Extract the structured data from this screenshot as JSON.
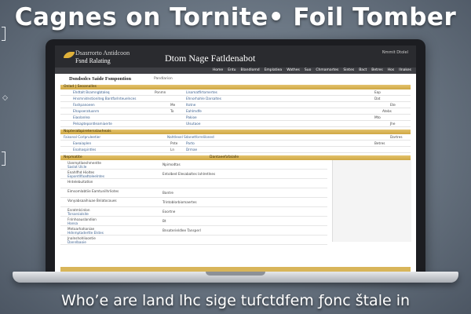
{
  "headline": "Cagnes on Tornite• Foil Tomber",
  "caption": "Who’e are land lhc sige tufctdfem ƒonc štale in",
  "site": {
    "logo_text": "Dsasrrorto Antidcoon",
    "logo_sub": "Fsnd Ralating",
    "title": "Dtom Nage Fatldenabot",
    "header_link": "Nmmit Dtolel",
    "nav": [
      "Home",
      "Entu",
      "Blandlomd",
      "Emplatiea",
      "Wathes",
      "Suo",
      "Chmamartes",
      "Sintes",
      "Bact",
      "Betres",
      "Hos",
      "Ilnakes"
    ]
  },
  "page": {
    "title": "Dsndsolcs Saide Fsmpontion",
    "subtitle": "Pandlarion"
  },
  "section1": {
    "label": "Onlad | Seoanalles",
    "rows": [
      {
        "c1": "Ehdtalt Bsamngbtaleq",
        "c2": "Ponmn",
        "c3": "Llsomatfirtomertes",
        "c4": "Eap"
      },
      {
        "c1": "Hnsmnidnstioniteg Bantfarlnteuelnces",
        "c2": "",
        "c3": "Ehnorhahle Darsaltes",
        "c4": "Dat"
      },
      {
        "c1": "Fashpanoeen",
        "c2": "Me",
        "c3": "Itotne",
        "c4": "Ete"
      },
      {
        "c1": "Ehapseratuonm",
        "c2": "To",
        "c3": "Eahlmdfe",
        "c4": "Atebs"
      },
      {
        "c1": "Eiaolanlea",
        "c2": "",
        "c3": "Pakioe",
        "c4": "Mto"
      },
      {
        "c1": "Pelsaptepontleamiaerte",
        "c2": "",
        "c3": "Ulsutaoe",
        "c4": "Jhe"
      }
    ]
  },
  "section2": {
    "label": "Nopteralbpiretersslaxheals",
    "rows": [
      {
        "c1": "Faisonal Corlpruleetier",
        "c2": "Nahtlexel Sdanetforreliloned",
        "c4": "Dartres"
      },
      {
        "c1": "Eaeaiaplen",
        "c2": "Pnte",
        "c3": "Parto",
        "c4": "Betres"
      },
      {
        "c1": "Enahaspintles",
        "c2": "Ln",
        "c3": "Drmae",
        "c4": ""
      }
    ]
  },
  "section3": {
    "label": "Nepmatite",
    "label_c": "Dantaeefafalalle",
    "rows": [
      {
        "q1": "Uanmptlaeshmentte",
        "q2": "Saslot Ulcle",
        "a": "Npimodtas"
      },
      {
        "q1": "Enahlfhd Hioltes",
        "q2": "Eopontllfaadtoleelntes",
        "a": "Entolbed Elesabaltes Iahlretlnes"
      },
      {
        "q1": "Hntelebuitatlon",
        "q2": "",
        "a": ""
      },
      {
        "q1": "Eimsomlabtiie Eamtunilhrliotes",
        "q2": "",
        "a": "Bantre"
      },
      {
        "q1": "Vonyabsaaihiuae Bnlatocoues",
        "q2": "",
        "a": "Trintoblorbiomaertes"
      },
      {
        "q1": "Esratmlcinlon",
        "q2": "Tsrsarsiolsite",
        "a": "Eoortne"
      },
      {
        "q1": "Fnlnhoauslandion",
        "q2": "Hansa",
        "a": "Bt"
      },
      {
        "q1": "Mntoarhahaniae",
        "q2": "Hdnmptadertte Elstes",
        "a": "Bnsoterieldlee Tansperl"
      },
      {
        "q1": "Jnalnshohlioontie",
        "q2": "Dannlbaoie",
        "a": ""
      }
    ]
  },
  "colors": {
    "accent": "#d4ad4a",
    "header": "#2a2b2f",
    "nav": "#3e3f44"
  }
}
